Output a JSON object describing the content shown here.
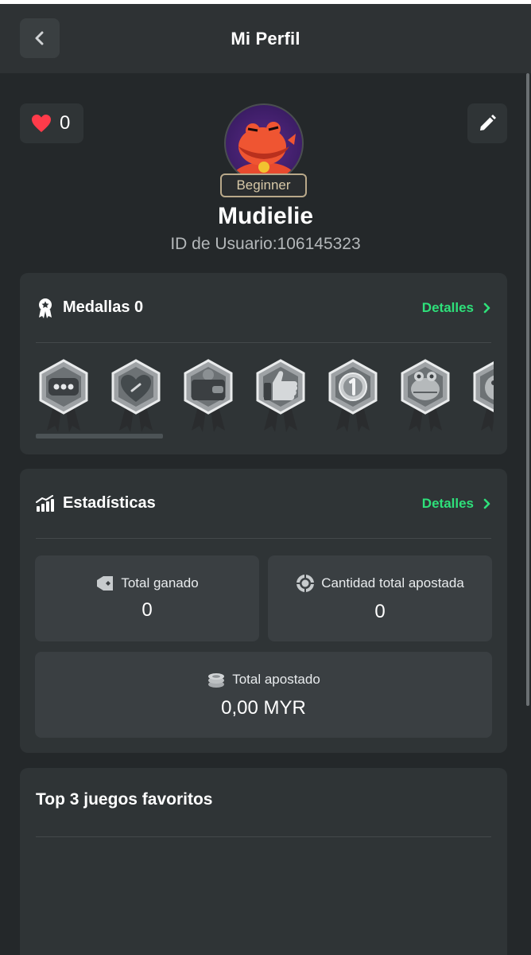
{
  "header": {
    "title": "Mi Perfil",
    "back_icon": "chevron-left-icon"
  },
  "profile": {
    "likes": "0",
    "like_icon": "heart-icon",
    "edit_icon": "pencil-icon",
    "level": "Beginner",
    "username": "Mudielie",
    "user_id": "ID de Usuario:106145323"
  },
  "medals": {
    "title": "Medallas 0",
    "details_label": "Detalles",
    "items": [
      {
        "icon": "chat-bubble-medal-icon"
      },
      {
        "icon": "heart-medal-icon"
      },
      {
        "icon": "wallet-medal-icon"
      },
      {
        "icon": "thumbs-up-medal-icon"
      },
      {
        "icon": "number-one-medal-icon"
      },
      {
        "icon": "crocodile-medal-icon"
      },
      {
        "icon": "mascot-medal-icon"
      }
    ]
  },
  "stats": {
    "title": "Estadísticas",
    "details_label": "Detalles",
    "total_won_label": "Total ganado",
    "total_won_value": "0",
    "total_bet_count_label": "Cantidad total apostada",
    "total_bet_count_value": "0",
    "total_bet_label": "Total apostado",
    "total_bet_value": "0,00 MYR"
  },
  "favorites": {
    "title": "Top 3 juegos favoritos"
  },
  "colors": {
    "background": "#24282a",
    "card": "#2f3436",
    "accent_green": "#2ee07a",
    "heart_red": "#ff3b4a",
    "badge_gold": "#b9a98a"
  }
}
